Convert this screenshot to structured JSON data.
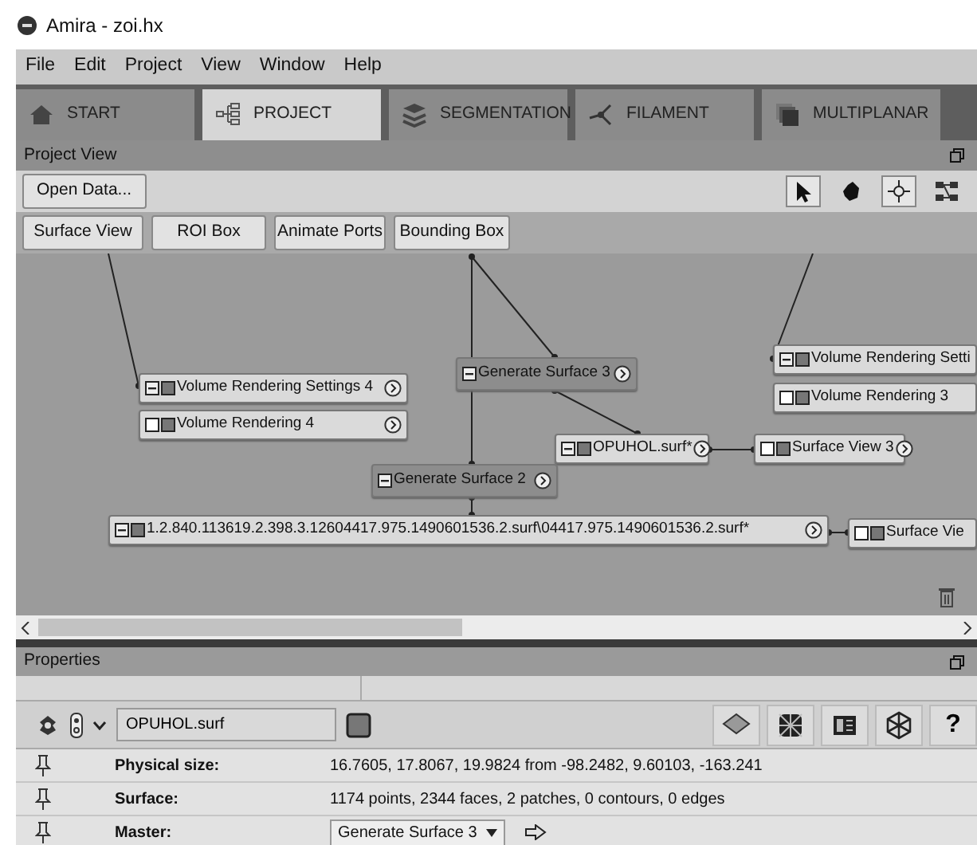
{
  "window": {
    "title": "Amira - zoi.hx"
  },
  "menu": [
    "File",
    "Edit",
    "Project",
    "View",
    "Window",
    "Help"
  ],
  "tabs": [
    {
      "label": "START",
      "selected": false
    },
    {
      "label": "PROJECT",
      "selected": true
    },
    {
      "label": "SEGMENTATION",
      "selected": false
    },
    {
      "label": "FILAMENT",
      "selected": false
    },
    {
      "label": "MULTIPLANAR",
      "selected": false
    }
  ],
  "project_view": {
    "title": "Project View",
    "open_button": "Open Data...",
    "tools": [
      {
        "selected": true
      },
      {
        "selected": false
      },
      {
        "selected": true
      },
      {
        "selected": false
      }
    ],
    "quick_buttons": [
      "Surface View",
      "ROI Box",
      "Animate Ports",
      "Bounding Box"
    ],
    "nodes": [
      {
        "label": "Volume Rendering Settings 4",
        "kind": "data"
      },
      {
        "label": "Volume Rendering 4",
        "kind": "display"
      },
      {
        "label": "Generate Surface 3",
        "kind": "compute"
      },
      {
        "label": "Volume Rendering Setti",
        "kind": "data"
      },
      {
        "label": "Volume Rendering 3",
        "kind": "display"
      },
      {
        "label": "OPUHOL.surf*",
        "kind": "data"
      },
      {
        "label": "Surface View 3",
        "kind": "display"
      },
      {
        "label": "Generate Surface 2",
        "kind": "compute"
      },
      {
        "label": "1.2.840.113619.2.398.3.12604417.975.1490601536.2.surf\\04417.975.1490601536.2.surf*",
        "kind": "data"
      },
      {
        "label": "Surface Vie",
        "kind": "display"
      }
    ]
  },
  "properties": {
    "title": "Properties",
    "object_name": "OPUHOL.surf",
    "help": "?",
    "rows": [
      {
        "label": "Physical size:",
        "value": "16.7605, 17.8067, 19.9824  from -98.2482, 9.60103, -163.241",
        "kind": "text"
      },
      {
        "label": "Surface:",
        "value": "1174 points, 2344 faces, 2 patches, 0 contours, 0 edges",
        "kind": "text"
      },
      {
        "label": "Master:",
        "value": "Generate Surface 3",
        "kind": "select"
      }
    ]
  }
}
